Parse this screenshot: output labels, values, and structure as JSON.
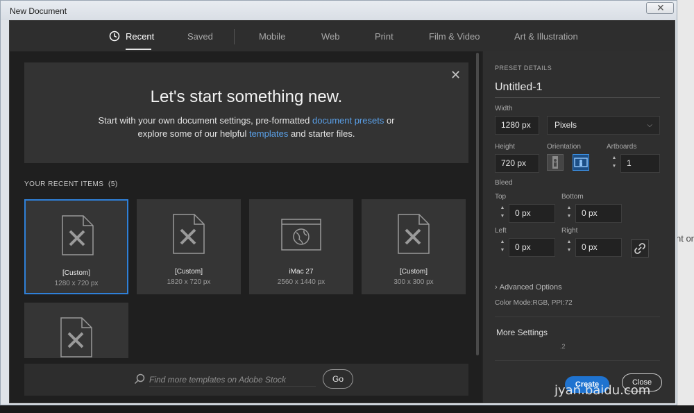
{
  "window": {
    "title": "New Document",
    "close_glyph": "✕"
  },
  "tabs": [
    {
      "label": "Recent",
      "icon": "clock-icon"
    },
    {
      "label": "Saved"
    },
    {
      "label": "Mobile"
    },
    {
      "label": "Web"
    },
    {
      "label": "Print"
    },
    {
      "label": "Film & Video"
    },
    {
      "label": "Art & Illustration"
    }
  ],
  "hero": {
    "title": "Let's start something new.",
    "line1_pre": "Start with your own document settings, pre-formatted ",
    "line1_link": "document presets",
    "line1_post": " or",
    "line2_pre": "explore some of our helpful ",
    "line2_link": "templates",
    "line2_post": " and starter files.",
    "close_glyph": "✕"
  },
  "recent": {
    "label": "YOUR RECENT ITEMS",
    "count": "(5)",
    "items": [
      {
        "name": "[Custom]",
        "size": "1280 x 720 px",
        "icon": "document-pencil-icon"
      },
      {
        "name": "[Custom]",
        "size": "1820 x 720 px",
        "icon": "document-pencil-icon"
      },
      {
        "name": "iMac 27",
        "size": "2560 x 1440 px",
        "icon": "browser-globe-icon"
      },
      {
        "name": "[Custom]",
        "size": "300 x 300 px",
        "icon": "document-pencil-icon"
      },
      {
        "name": "",
        "size": "",
        "icon": "document-pencil-icon"
      }
    ]
  },
  "search": {
    "placeholder": "Find more templates on Adobe Stock",
    "go_label": "Go"
  },
  "preset": {
    "heading": "PRESET DETAILS",
    "name": "Untitled-1",
    "width_label": "Width",
    "width_value": "1280 px",
    "unit": "Pixels",
    "height_label": "Height",
    "height_value": "720 px",
    "orientation_label": "Orientation",
    "artboards_label": "Artboards",
    "artboards_value": "1",
    "bleed_label": "Bleed",
    "top_label": "Top",
    "top_value": "0 px",
    "bottom_label": "Bottom",
    "bottom_value": "0 px",
    "left_label": "Left",
    "left_value": "0 px",
    "right_label": "Right",
    "right_value": "0 px",
    "advanced_label": "Advanced Options",
    "color_mode": "Color Mode:RGB, PPI:72",
    "more_settings": "More Settings",
    "small_text": ".2",
    "create_label": "Create",
    "close_label": "Close"
  },
  "background": {
    "right_text": "nt or"
  },
  "watermark": "jyan.baidu.com"
}
